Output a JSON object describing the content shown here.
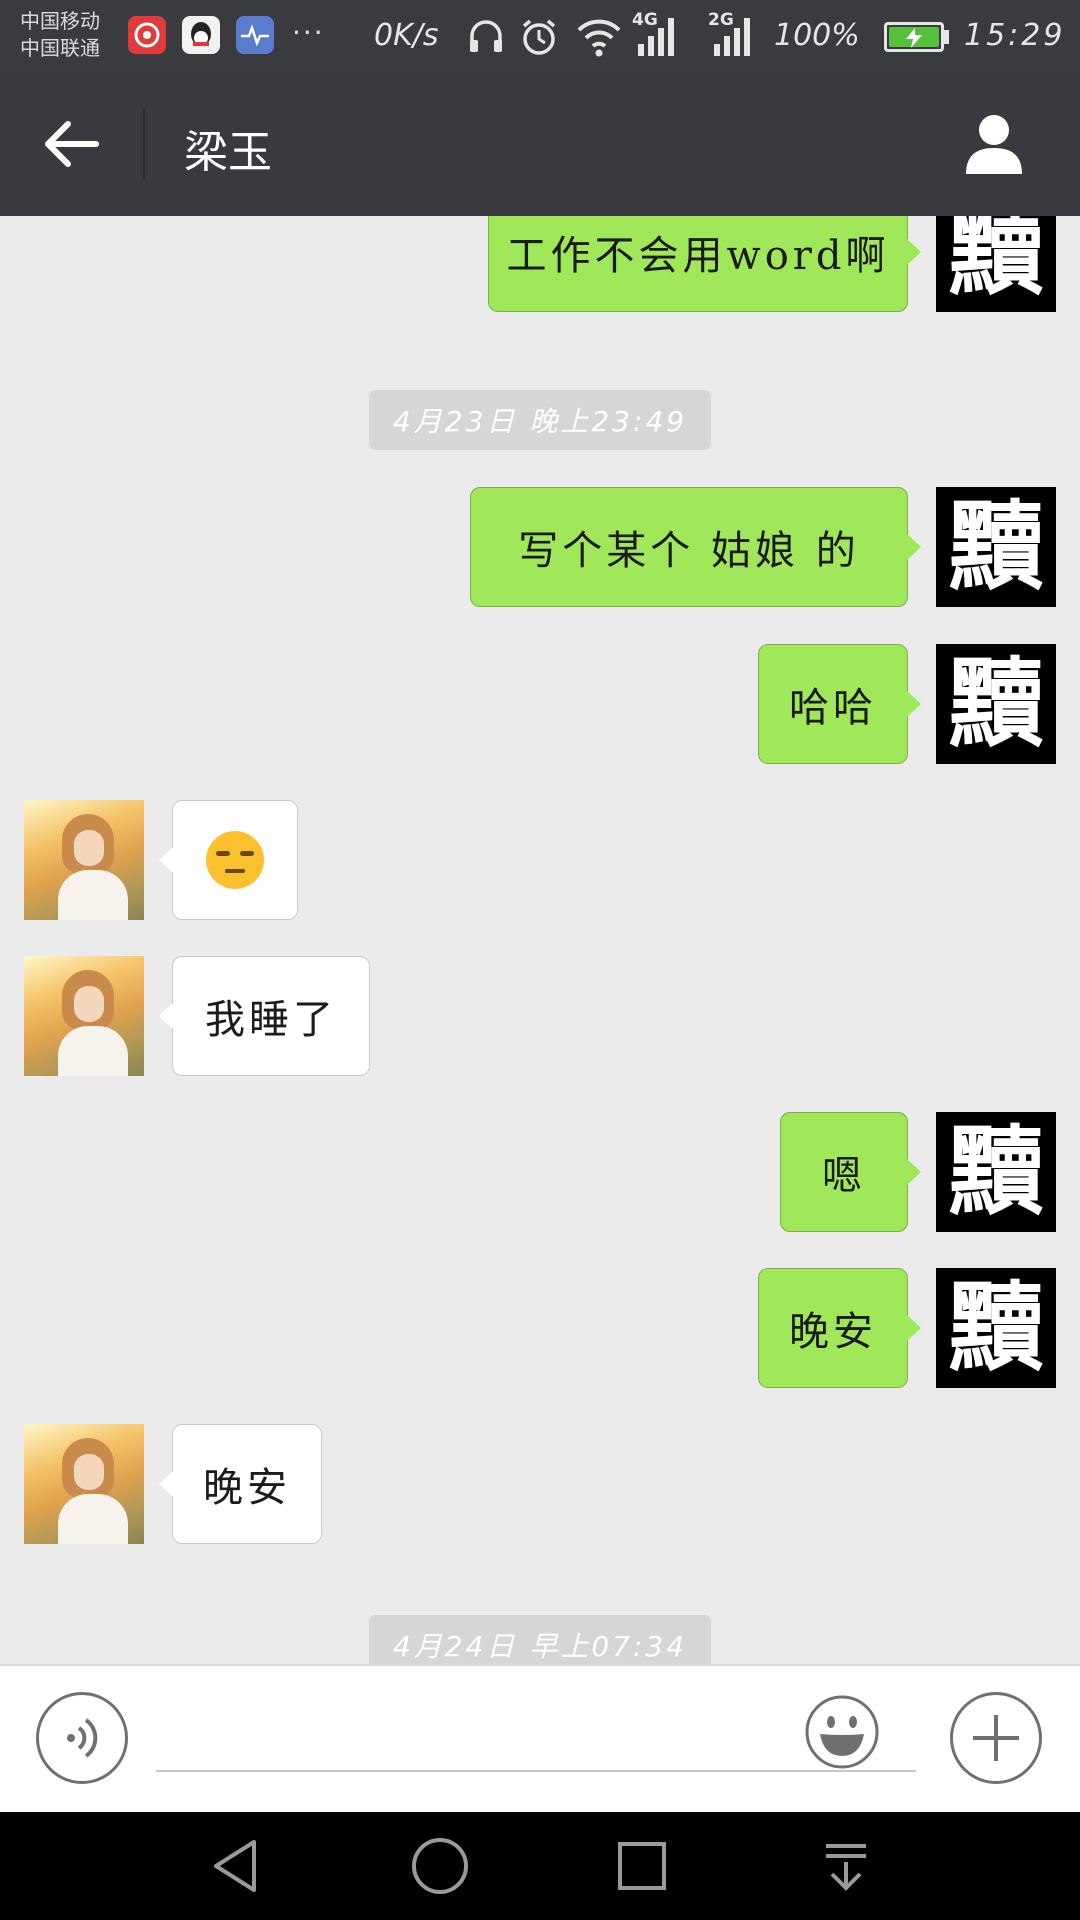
{
  "status_bar": {
    "carrier_1": "中国移动",
    "carrier_2": "中国联通",
    "more": "···",
    "net_speed": "0K/s",
    "net_4g": "4G",
    "net_2g": "2G",
    "battery": "100%",
    "time": "15:29",
    "icons": [
      "netease-music-icon",
      "qq-icon",
      "health-icon",
      "headphones-icon",
      "alarm-icon",
      "wifi-icon",
      "signal-4g-icon",
      "signal-2g-icon",
      "battery-charging-icon"
    ],
    "colors": {
      "bg": "#3a3b3f",
      "battery_fill": "#54c13b"
    }
  },
  "header": {
    "title": "梁玉",
    "back_icon": "back-arrow-icon",
    "profile_icon": "person-icon"
  },
  "messages": [
    {
      "side": "out",
      "text": "工作不会用word啊"
    },
    {
      "type": "timestamp",
      "text": "4月23日 晚上23:49"
    },
    {
      "side": "out",
      "text": "写个某个 姑娘 的"
    },
    {
      "side": "out",
      "text": "哈哈"
    },
    {
      "side": "in",
      "emoji": "unamused-face"
    },
    {
      "side": "in",
      "text": "我睡了"
    },
    {
      "side": "out",
      "text": "嗯"
    },
    {
      "side": "out",
      "text": "晚安"
    },
    {
      "side": "in",
      "text": "晚安"
    },
    {
      "type": "timestamp",
      "text": "4月24日 早上07:34"
    }
  ],
  "my_avatar_char": "黷",
  "input_bar": {
    "value": "",
    "voice_icon": "voice-icon",
    "emoji_icon": "emoji-icon",
    "plus_icon": "plus-icon"
  },
  "nav_bar": {
    "buttons": [
      "back-triangle-icon",
      "home-circle-icon",
      "recents-square-icon",
      "notification-pull-icon"
    ]
  },
  "colors": {
    "chat_bg": "#ebebeb",
    "bubble_out": "#a0e75a",
    "bubble_in": "#ffffff",
    "header_bg": "#393a3f"
  }
}
